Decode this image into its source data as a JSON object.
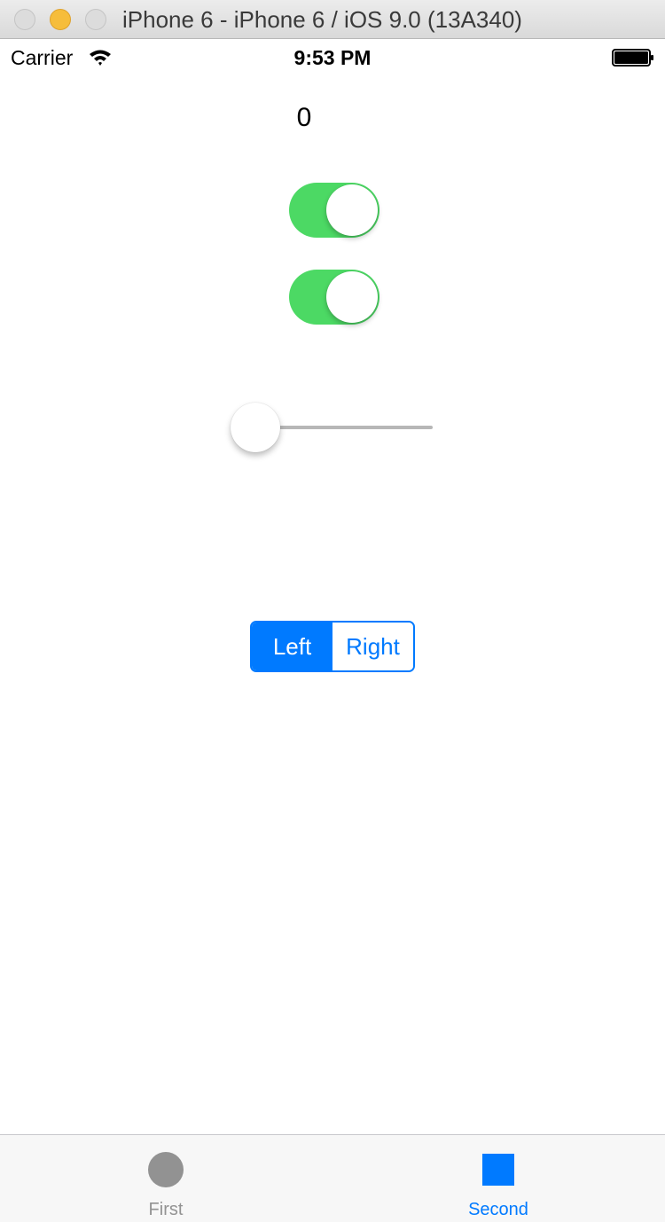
{
  "window": {
    "title": "iPhone 6 - iPhone 6 / iOS 9.0 (13A340)"
  },
  "status_bar": {
    "carrier": "Carrier",
    "wifi_icon": "wifi-icon",
    "time": "9:53 PM",
    "battery_icon": "battery-icon"
  },
  "content": {
    "value_label": "0",
    "switch_1": {
      "on": true
    },
    "switch_2": {
      "on": true
    },
    "slider": {
      "value": 0
    },
    "segmented_control": {
      "segments": [
        "Left",
        "Right"
      ],
      "selected_index": 0
    }
  },
  "tab_bar": {
    "tabs": [
      {
        "label": "First",
        "icon": "circle-icon",
        "selected": false
      },
      {
        "label": "Second",
        "icon": "square-icon",
        "selected": true
      }
    ]
  },
  "colors": {
    "accent": "#007aff",
    "switch_on": "#4cd964",
    "tab_inactive": "#929292"
  }
}
